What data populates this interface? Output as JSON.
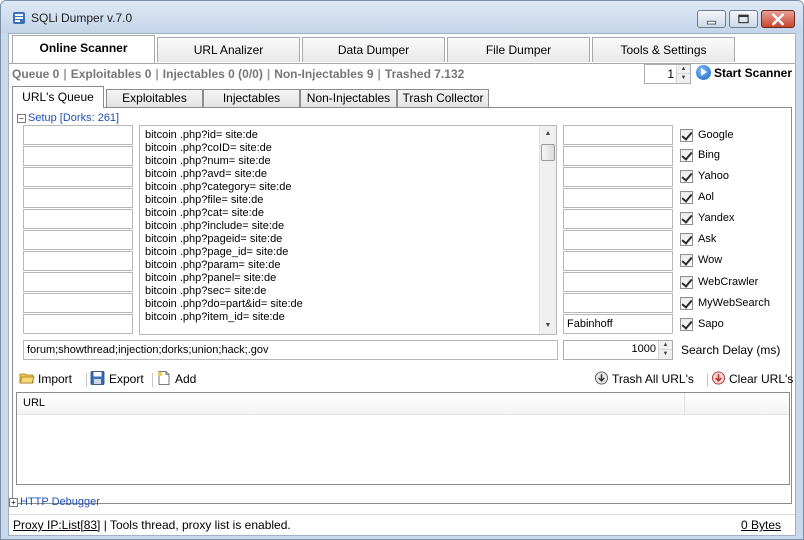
{
  "window": {
    "title": "SQLi Dumper v.7.0"
  },
  "main_tabs": [
    {
      "label": "Online Scanner",
      "active": true
    },
    {
      "label": "URL Analizer",
      "active": false
    },
    {
      "label": "Data Dumper",
      "active": false
    },
    {
      "label": "File Dumper",
      "active": false
    },
    {
      "label": "Tools & Settings",
      "active": false
    }
  ],
  "stats": {
    "queue": "Queue 0",
    "exploitables": "Exploitables 0",
    "injectables": "Injectables 0 (0/0)",
    "non_injectables": "Non-Injectables 9",
    "trashed": "Trashed 7.132"
  },
  "threads_value": "1",
  "start_scanner_label": "Start Scanner",
  "sub_tabs": [
    {
      "label": "URL's Queue",
      "active": true
    },
    {
      "label": "Exploitables",
      "active": false
    },
    {
      "label": "Injectables",
      "active": false
    },
    {
      "label": "Non-Injectables",
      "active": false
    },
    {
      "label": "Trash Collector",
      "active": false
    }
  ],
  "setup_label": "Setup [Dorks: 261]",
  "dorks": [
    "bitcoin .php?id= site:de",
    "bitcoin .php?coID= site:de",
    "bitcoin .php?num= site:de",
    "bitcoin .php?avd= site:de",
    "bitcoin .php?category= site:de",
    "bitcoin .php?file= site:de",
    "bitcoin .php?cat= site:de",
    "bitcoin .php?include= site:de",
    "bitcoin .php?pageid= site:de",
    "bitcoin .php?page_id= site:de",
    "bitcoin .php?param= site:de",
    "bitcoin .php?panel= site:de",
    "bitcoin .php?sec= site:de",
    "bitcoin .php?do=part&id= site:de",
    "bitcoin .php?item_id= site:de"
  ],
  "right_fields": [
    "",
    "",
    "",
    "",
    "",
    "",
    "",
    "",
    "",
    "Fabinhoff"
  ],
  "engines": [
    {
      "label": "Google",
      "checked": true
    },
    {
      "label": "Bing",
      "checked": true
    },
    {
      "label": "Yahoo",
      "checked": true
    },
    {
      "label": "Aol",
      "checked": true
    },
    {
      "label": "Yandex",
      "checked": true
    },
    {
      "label": "Ask",
      "checked": true
    },
    {
      "label": "Wow",
      "checked": true
    },
    {
      "label": "WebCrawler",
      "checked": true
    },
    {
      "label": "MyWebSearch",
      "checked": true
    },
    {
      "label": "Sapo",
      "checked": true
    }
  ],
  "exclude_words": "forum;showthread;injection;dorks;union;hack;.gov",
  "search_delay": {
    "value": "1000",
    "label": "Search Delay (ms)"
  },
  "toolbar": {
    "import": "Import",
    "export": "Export",
    "add": "Add",
    "trash_all": "Trash All URL's",
    "clear": "Clear URL's"
  },
  "url_table": {
    "columns": [
      "URL",
      ""
    ],
    "rows": []
  },
  "http_debugger_label": "HTTP Debugger",
  "statusbar": {
    "proxy": "Proxy IP:List[83]",
    "message": "|  Tools thread, proxy list is enabled.",
    "bytes": "0 Bytes"
  }
}
